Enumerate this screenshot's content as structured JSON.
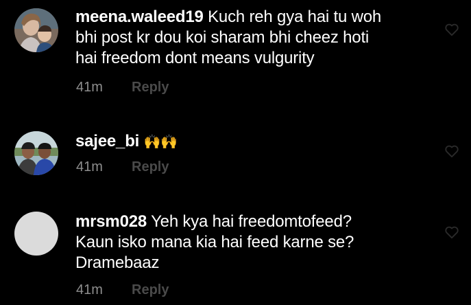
{
  "comments": [
    {
      "username": "meena.waleed19",
      "text": "Kuch reh gya hai tu woh",
      "text_line2": "bhi post kr dou koi sharam bhi cheez hoti",
      "text_line3": "hai freedom dont  means vulgurity",
      "time": "41m",
      "reply_label": "Reply"
    },
    {
      "username": "sajee_bi",
      "text": "🙌🙌",
      "time": "41m",
      "reply_label": "Reply"
    },
    {
      "username": "mrsm028",
      "text": "Yeh kya hai freedomtofeed?",
      "text_line2": "Kaun isko mana kia hai feed karne se?",
      "text_line3": "Dramebaaz",
      "time": "41m",
      "reply_label": "Reply"
    }
  ],
  "colors": {
    "background": "#000000",
    "text": "#ffffff",
    "meta": "#8e8e8e",
    "reply": "#4a4a4a",
    "heart_outline": "#2a2a2a"
  },
  "icons": {
    "like": "heart-outline-icon",
    "emoji": "raised-hands-emoji"
  }
}
